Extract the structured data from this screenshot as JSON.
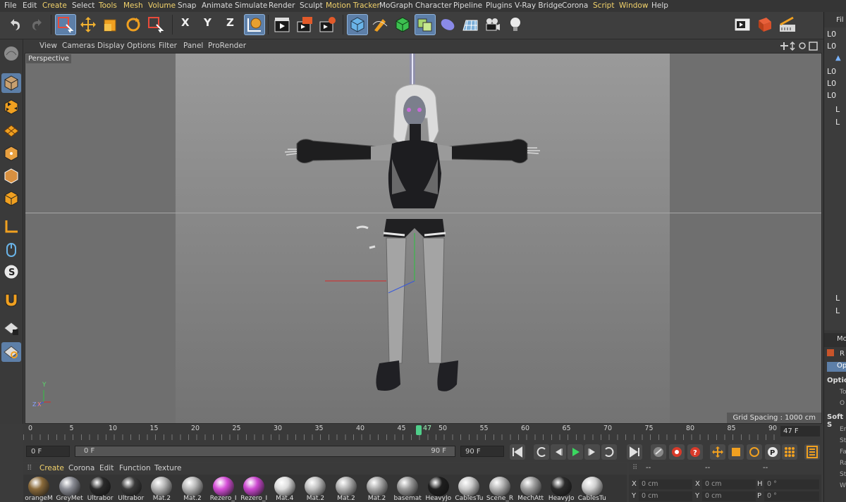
{
  "menu": [
    "File",
    "Edit",
    "Create",
    "Select",
    "Tools",
    "Mesh",
    "Volume",
    "Snap",
    "Animate",
    "Simulate",
    "Render",
    "Sculpt",
    "Motion Tracker",
    "MoGraph",
    "Character",
    "Pipeline",
    "Plugins",
    "V-Ray Bridge",
    "Corona",
    "Script",
    "Window",
    "Help"
  ],
  "menu_highlighted": [
    "Create",
    "Tools",
    "Mesh",
    "Volume",
    "Motion Tracker",
    "Script",
    "Window"
  ],
  "toolbar": {
    "axis_x": "X",
    "axis_y": "Y",
    "axis_z": "Z",
    "icons": [
      "undo-icon",
      "redo-icon",
      "live-selection-icon",
      "move-icon",
      "scale-icon",
      "rotate-icon",
      "recent-tools-icon",
      "world-coordinates-icon",
      "render-view-icon",
      "render-picture-viewer-icon",
      "render-settings-icon",
      "cube-icon",
      "pen-spline-icon",
      "subdivision-icon",
      "array-icon",
      "deformer-icon",
      "floor-icon",
      "camera-icon",
      "light-icon",
      "picture-viewer-icon",
      "content-browser-icon",
      "layout-icon"
    ]
  },
  "viewport": {
    "menu": [
      "View",
      "Cameras",
      "Display",
      "Options",
      "Filter",
      "Panel",
      "ProRender"
    ],
    "label": "Perspective",
    "grid_spacing": "Grid Spacing : 1000 cm",
    "axis_y_label": "Y",
    "axis_x_label": "X",
    "axis_z_label": "Z"
  },
  "right_panel": {
    "header": "Fil",
    "items": [
      "L0",
      "L0",
      "L0",
      "L0",
      "L0",
      "L",
      "L",
      "L",
      "L"
    ],
    "attr_header": "Mo",
    "attr_tab": "R",
    "opt_tab": "Opt",
    "section1": "Optio",
    "fields1": [
      "To",
      "O"
    ],
    "section2": "Soft S",
    "fields2": [
      "En",
      "St",
      "Fa",
      "Ra",
      "St",
      "W"
    ]
  },
  "timeline": {
    "ticks": [
      "0",
      "5",
      "10",
      "15",
      "20",
      "25",
      "30",
      "35",
      "40",
      "45",
      "50",
      "55",
      "60",
      "65",
      "70",
      "75",
      "80",
      "85",
      "90"
    ],
    "current_frame": "47",
    "end_frame_field": "47 F"
  },
  "transport": {
    "start_field": "0 F",
    "range_start": "0 F",
    "range_end": "90 F",
    "end_field": "90 F"
  },
  "materials": {
    "menu": [
      "Create",
      "Corona",
      "Edit",
      "Function",
      "Texture"
    ],
    "items": [
      {
        "name": "orangeM",
        "color": "#8a6a3a"
      },
      {
        "name": "GreyMet",
        "color": "#8a8c94"
      },
      {
        "name": "Ultrabor",
        "color": "#2a2a2a"
      },
      {
        "name": "Ultrabor",
        "color": "#3a3a3a"
      },
      {
        "name": "Mat.2",
        "color": "#b5b5b5"
      },
      {
        "name": "Mat.2",
        "color": "#b8b8b8"
      },
      {
        "name": "Rezero_I",
        "color": "#d64fd8"
      },
      {
        "name": "Rezero_I",
        "color": "#cc48d0"
      },
      {
        "name": "Mat.4",
        "color": "#dcdcdc"
      },
      {
        "name": "Mat.2",
        "color": "#c0c0c0"
      },
      {
        "name": "Mat.2",
        "color": "#b0b0b0"
      },
      {
        "name": "Mat.2",
        "color": "#a8a8a8"
      },
      {
        "name": "basemat",
        "color": "#9a9a9a"
      },
      {
        "name": "HeavyJo",
        "color": "#1e1e1e"
      },
      {
        "name": "CablesTu",
        "color": "#c9c9c9"
      },
      {
        "name": "Scene_R",
        "color": "#b3b3b3"
      },
      {
        "name": "MechAtt",
        "color": "#9e9e9e"
      },
      {
        "name": "HeavyJo",
        "color": "#2b2b2b"
      },
      {
        "name": "CablesTu",
        "color": "#cfcfcf"
      }
    ]
  },
  "coordinates": {
    "header": [
      "--",
      "--",
      "--"
    ],
    "row1": {
      "l1": "X",
      "v1": "0 cm",
      "l2": "X",
      "v2": "0 cm",
      "l3": "H",
      "v3": "0 °"
    },
    "row2": {
      "l1": "Y",
      "v1": "0 cm",
      "l2": "Y",
      "v2": "0 cm",
      "l3": "P",
      "v3": "0 °"
    }
  },
  "colors": {
    "accent_selected": "#5d7fa8",
    "menu_highlight": "#f3d36b",
    "playhead": "#4fcf8a"
  }
}
